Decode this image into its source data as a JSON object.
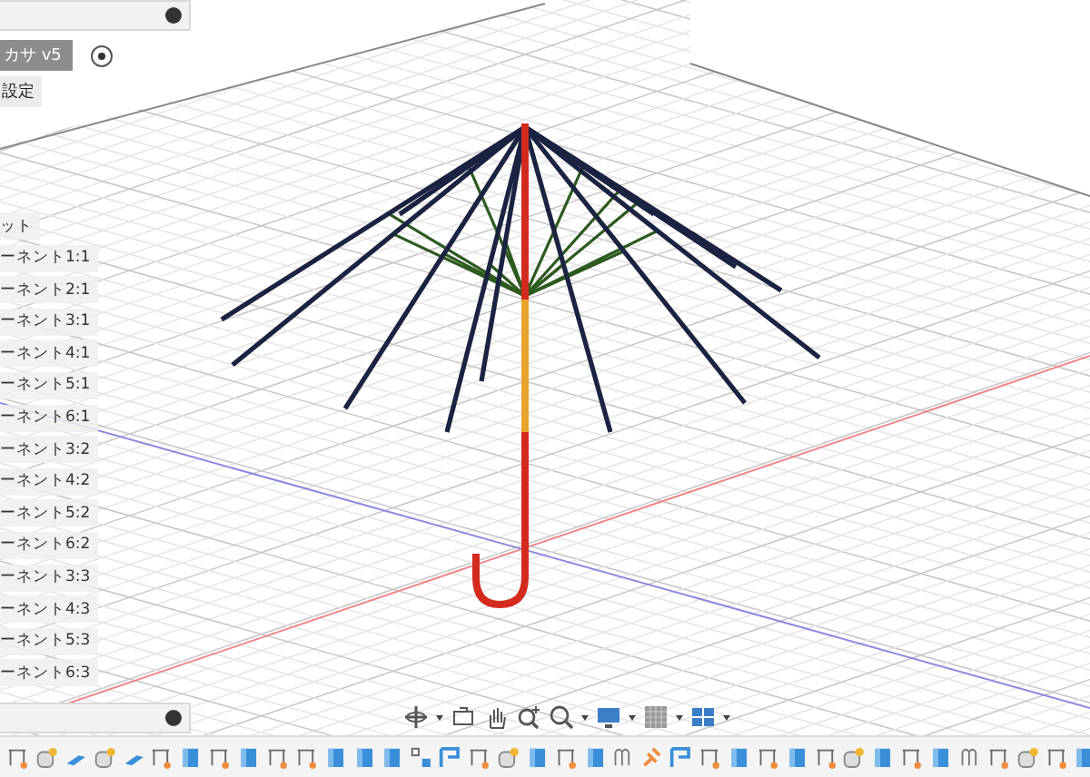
{
  "browser": {
    "document": "カサ v5",
    "settings": "設定",
    "items": [
      {
        "label": "ット"
      },
      {
        "label": "ーネント1:1"
      },
      {
        "label": "ーネント2:1"
      },
      {
        "label": "ーネント3:1"
      },
      {
        "label": "ーネント4:1"
      },
      {
        "label": "ーネント5:1"
      },
      {
        "label": "ーネント6:1"
      },
      {
        "label": "ーネント3:2"
      },
      {
        "label": "ーネント4:2"
      },
      {
        "label": "ーネント5:2"
      },
      {
        "label": "ーネント6:2"
      },
      {
        "label": "ーネント3:3"
      },
      {
        "label": "ーネント4:3"
      },
      {
        "label": "ーネント5:3"
      },
      {
        "label": "ーネント6:3"
      }
    ]
  }
}
